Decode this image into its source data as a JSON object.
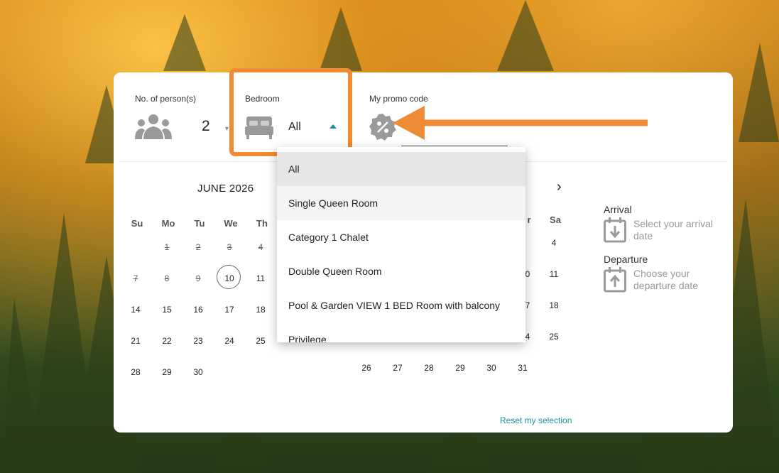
{
  "booking": {
    "persons_label": "No. of person(s)",
    "persons_value": "2",
    "bedroom_label": "Bedroom",
    "bedroom_value": "All",
    "promo_label": "My promo code"
  },
  "calendar": {
    "month_title": "JUNE 2026",
    "weekdays": [
      "Su",
      "Mo",
      "Tu",
      "We",
      "Th"
    ],
    "right_weekday_partial": "r",
    "right_weekday_sa": "Sa",
    "weeks": [
      [
        "",
        "1",
        "2",
        "3",
        "4"
      ],
      [
        "7",
        "8",
        "9",
        "10",
        "11"
      ],
      [
        "14",
        "15",
        "16",
        "17",
        "18"
      ],
      [
        "21",
        "22",
        "23",
        "24",
        "25"
      ],
      [
        "28",
        "29",
        "30",
        "",
        ""
      ]
    ],
    "right_col_sa": [
      "4",
      "11",
      "18",
      "25"
    ],
    "right_partial": [
      "0",
      "7",
      "4"
    ],
    "right_bottom_row": [
      "26",
      "27",
      "28",
      "29",
      "30",
      "31"
    ],
    "today": "10"
  },
  "summary": {
    "arrival_label": "Arrival",
    "arrival_hint": "Select your arrival date",
    "departure_label": "Departure",
    "departure_hint": "Choose your departure date"
  },
  "reset_label": "Reset my selection",
  "dropdown": {
    "options": [
      "All",
      "Single Queen Room",
      "Category 1 Chalet",
      "Double Queen Room",
      "Pool & Garden VIEW 1 BED Room with balcony",
      "Privilege"
    ],
    "selected_index": 0,
    "hover_index": 1
  },
  "colors": {
    "accent": "#1a8fa3",
    "annotation": "#ef8b35",
    "icon_gray": "#9a9a9a"
  }
}
